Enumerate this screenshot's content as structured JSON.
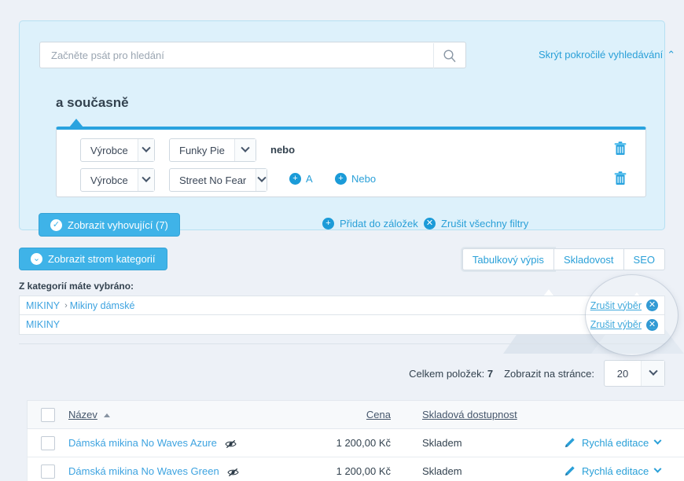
{
  "advanced_search": {
    "search_placeholder": "Začněte psát pro hledání",
    "search_value": "",
    "search_icon": "search-icon",
    "toggle_label": "Skrýt pokročilé vyhledávání",
    "toggle_caret": "chevron-up-icon",
    "group_label": "a současně",
    "conditions": [
      {
        "field": "Výrobce",
        "value": "Funky Pie",
        "joiner": "nebo",
        "delete_icon": "trash-icon"
      },
      {
        "field": "Výrobce",
        "value": "Street No Fear",
        "delete_icon": "trash-icon"
      }
    ],
    "add_and_label": "A",
    "add_or_label": "Nebo",
    "show_matching_label": "Zobrazit vyhovující (7)",
    "add_bookmark_label": "Přidat do záložek",
    "clear_filters_label": "Zrušit všechny filtry"
  },
  "categories": {
    "tree_button_label": "Zobrazit strom kategorií",
    "selected_label": "Z kategorií máte vybráno:",
    "cancel_label": "Zrušit výběr",
    "rows": [
      {
        "path": [
          "MIKINY",
          "Mikiny dámské"
        ],
        "separator": "›"
      },
      {
        "path": [
          "MIKINY"
        ],
        "separator": ""
      }
    ]
  },
  "tabs": [
    {
      "label": "Tabulkový výpis",
      "active": true
    },
    {
      "label": "Skladovost",
      "active": false
    },
    {
      "label": "SEO",
      "active": false
    }
  ],
  "pagination": {
    "total_label": "Celkem položek:",
    "total_value": "7",
    "per_page_label": "Zobrazit na stránce:",
    "per_page_value": "20"
  },
  "table": {
    "columns": [
      {
        "key": "name",
        "label": "Název",
        "sort": "asc"
      },
      {
        "key": "price",
        "label": "Cena"
      },
      {
        "key": "stock",
        "label": "Skladová dostupnost"
      }
    ],
    "quick_edit_label": "Rychlá editace",
    "rows": [
      {
        "name": "Dámská mikina No Waves Azure",
        "visibility_icon": "eye-slash-icon",
        "price": "1 200,00 Kč",
        "stock": "Skladem"
      },
      {
        "name": "Dámská mikina No Waves Green",
        "visibility_icon": "eye-slash-icon",
        "price": "1 200,00 Kč",
        "stock": "Skladem"
      }
    ]
  },
  "colors": {
    "accent": "#2aa0d8",
    "button": "#3fb3e8",
    "panel_bg": "#ddf1fb",
    "page_bg": "#edf1f7",
    "link": "#3da3e0"
  }
}
